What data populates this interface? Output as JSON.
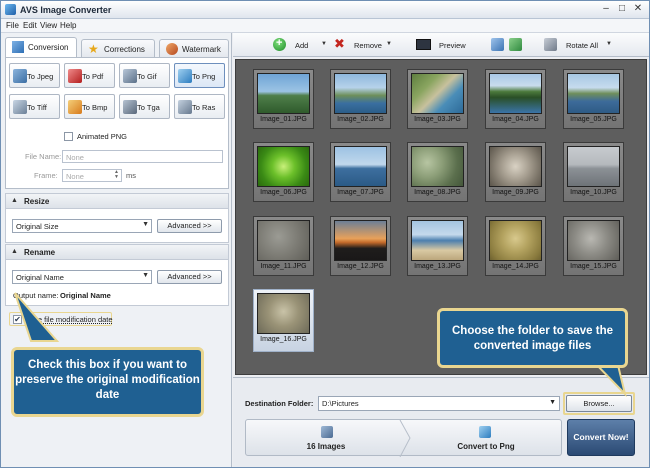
{
  "window": {
    "title": "AVS Image Converter",
    "controls": {
      "minimize": "–",
      "maximize": "□",
      "close": "✕"
    }
  },
  "menu": [
    "File",
    "Edit",
    "View",
    "Help"
  ],
  "tabs": [
    "Conversion",
    "Corrections",
    "Watermark"
  ],
  "formats": [
    "To Jpeg",
    "To Pdf",
    "To Gif",
    "To Png",
    "To Tiff",
    "To Bmp",
    "To Tga",
    "To Ras"
  ],
  "options": {
    "animated_png": "Animated PNG",
    "file_name_label": "File Name:",
    "file_name_value": "None",
    "frame_label": "Frame:",
    "frame_value": "None",
    "frame_unit": "ms"
  },
  "resize": {
    "title": "Resize",
    "value": "Original Size",
    "advanced": "Advanced >>"
  },
  "rename": {
    "title": "Rename",
    "value": "Original Name",
    "advanced": "Advanced >>",
    "output_label": "Output name:",
    "output_value": "Original Name"
  },
  "save_date": {
    "label": "Save file modification date",
    "checked": "✔"
  },
  "toolbar": {
    "add": "Add",
    "remove": "Remove",
    "preview": "Preview",
    "rotate_all": "Rotate All",
    "dropdown": "▼"
  },
  "images": [
    "Image_01.JPG",
    "Image_02.JPG",
    "Image_03.JPG",
    "Image_04.JPG",
    "Image_05.JPG",
    "Image_06.JPG",
    "Image_07.JPG",
    "Image_08.JPG",
    "Image_09.JPG",
    "Image_10.JPG",
    "Image_11.JPG",
    "Image_12.JPG",
    "Image_13.JPG",
    "Image_14.JPG",
    "Image_15.JPG",
    "Image_16.JPG"
  ],
  "destination": {
    "label": "Destination Folder:",
    "value": "D:\\Pictures",
    "browse": "Browse..."
  },
  "steps": {
    "count": "16 Images",
    "target": "Convert to Png",
    "convert_now": "Convert Now!"
  },
  "callouts": {
    "left": "Check this box if you want to preserve the original modification date",
    "right": "Choose the folder to save the converted image files"
  },
  "colors": {
    "accent": "#1f6092",
    "highlight": "#e9d690",
    "gallery_bg": "#5e5e5e"
  }
}
